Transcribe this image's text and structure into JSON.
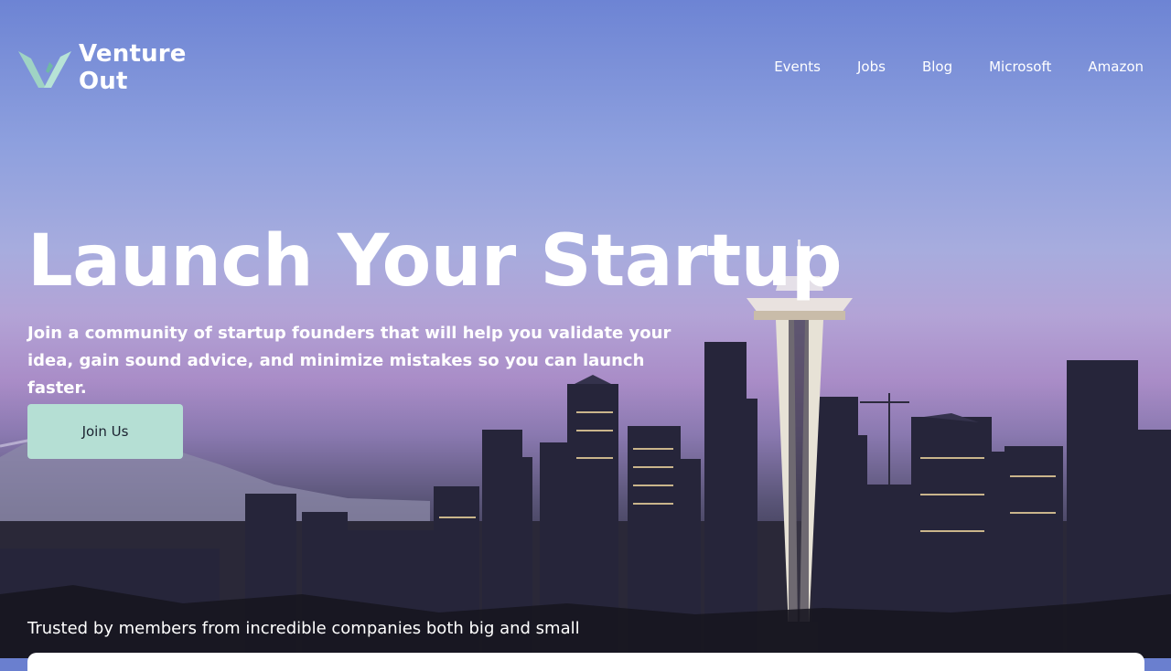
{
  "brand": {
    "line1": "Venture",
    "line2": "Out"
  },
  "nav": {
    "items": [
      {
        "label": "Events"
      },
      {
        "label": "Jobs"
      },
      {
        "label": "Blog"
      },
      {
        "label": "Microsoft"
      },
      {
        "label": "Amazon"
      }
    ]
  },
  "hero": {
    "title": "Launch Your Startup",
    "subtitle": "Join a community of startup founders that will help you validate your idea, gain sound advice, and minimize mistakes so you can launch faster.",
    "cta_label": "Join Us"
  },
  "trusted": {
    "text": "Trusted by members from incredible companies both big and small"
  },
  "colors": {
    "accent": "#b5dfd4",
    "logo": "#9fd3c4"
  }
}
